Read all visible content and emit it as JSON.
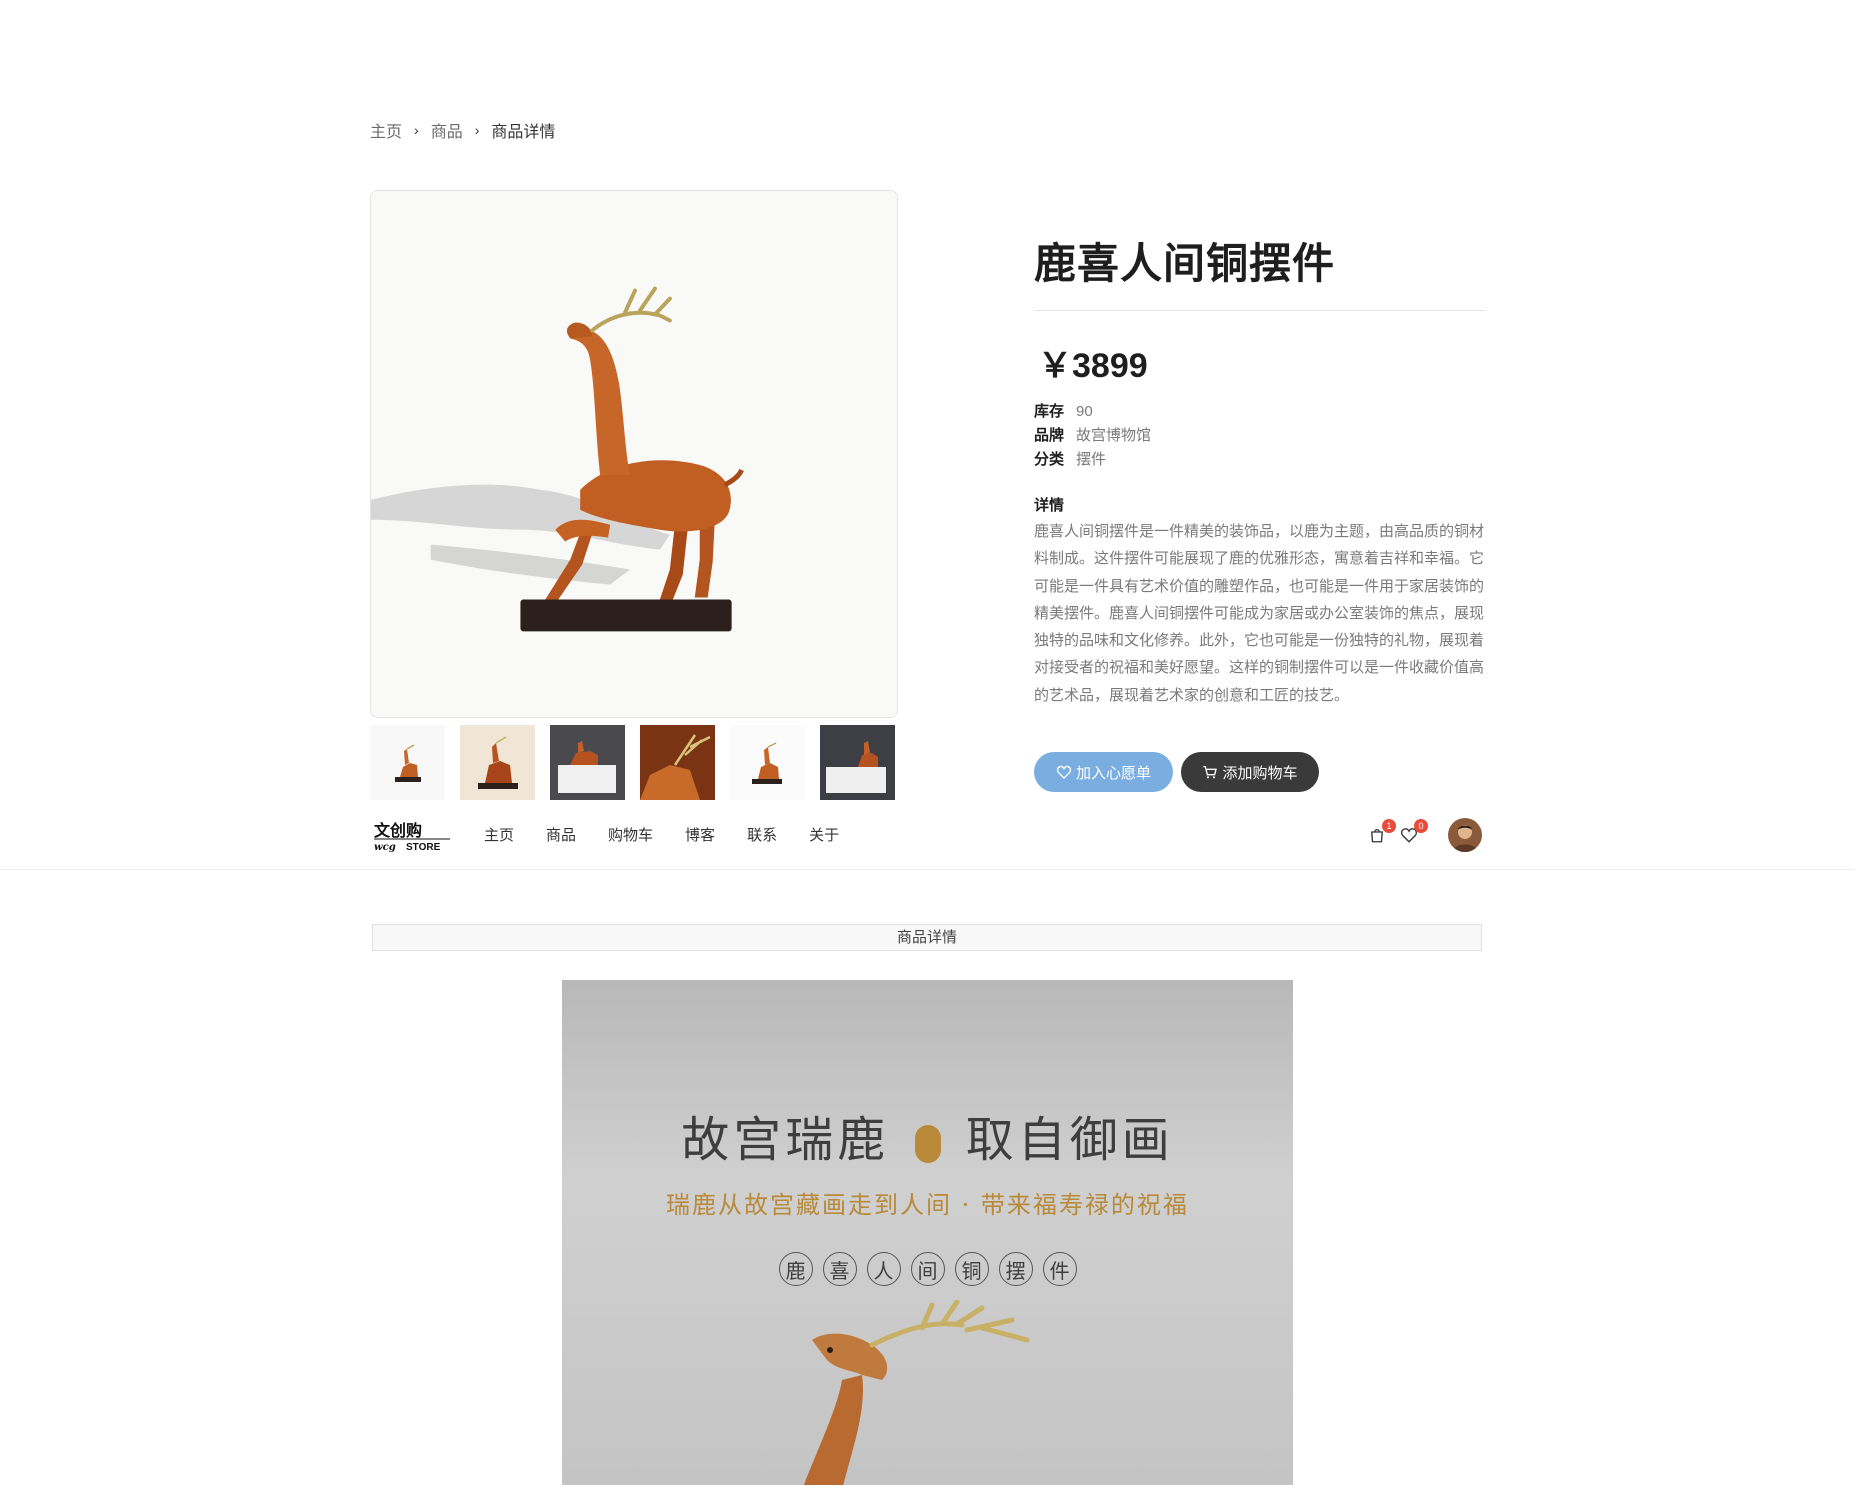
{
  "breadcrumb": {
    "home": "主页",
    "products": "商品",
    "current": "商品详情"
  },
  "product": {
    "title": "鹿喜人间铜摆件",
    "price": "￥3899",
    "specs": {
      "stock_label": "库存",
      "stock_value": "90",
      "brand_label": "品牌",
      "brand_value": "故宫博物馆",
      "category_label": "分类",
      "category_value": "摆件"
    },
    "detail_label": "详情",
    "detail_text": "鹿喜人间铜摆件是一件精美的装饰品，以鹿为主题，由高品质的铜材料制成。这件摆件可能展现了鹿的优雅形态，寓意着吉祥和幸福。它可能是一件具有艺术价值的雕塑作品，也可能是一件用于家居装饰的精美摆件。鹿喜人间铜摆件可能成为家居或办公室装饰的焦点，展现独特的品味和文化修养。此外，它也可能是一份独特的礼物，展现着对接受者的祝福和美好愿望。这样的铜制摆件可以是一件收藏价值高的艺术品，展现着艺术家的创意和工匠的技艺。",
    "wishlist_button": "加入心愿单",
    "cart_button": "添加购物车"
  },
  "navbar": {
    "logo_text": "文创购",
    "logo_sub": "STORE",
    "links": [
      "主页",
      "商品",
      "购物车",
      "博客",
      "联系",
      "关于"
    ],
    "cart_count": "1",
    "wishlist_count": "0"
  },
  "tab": {
    "label": "商品详情"
  },
  "poster": {
    "title_left": "故宫瑞鹿",
    "title_right": "取自御画",
    "subtitle": "瑞鹿从故宫藏画走到人间 · 带来福寿禄的祝福",
    "chars": [
      "鹿",
      "喜",
      "人",
      "间",
      "铜",
      "摆",
      "件"
    ]
  },
  "colors": {
    "accent_blue": "#7aaee0",
    "dark_button": "#3a3a3a",
    "badge_red": "#e74c3c",
    "gold": "#b88a3a"
  }
}
